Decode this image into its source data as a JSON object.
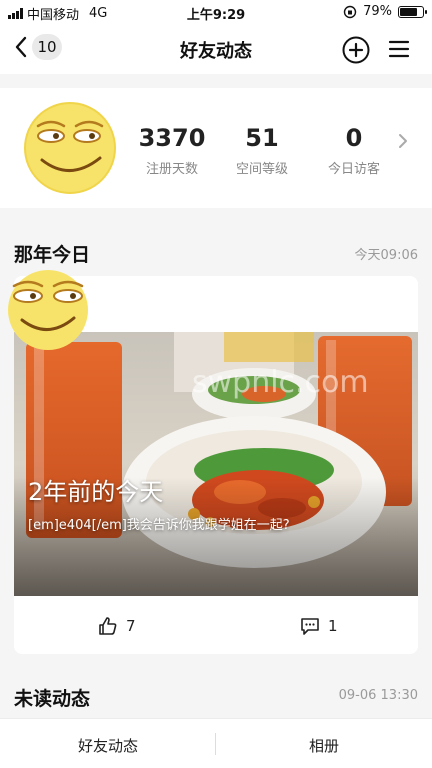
{
  "status": {
    "carrier": "中国移动",
    "network": "4G",
    "time": "上午9:29",
    "battery_text": "79%",
    "battery_level": 0.79
  },
  "nav": {
    "back_count": "10",
    "title": "好友动态",
    "add_icon": "plus-circle-icon",
    "menu_icon": "hamburger-menu-icon"
  },
  "profile": {
    "stats": [
      {
        "value": "3370",
        "label": "注册天数"
      },
      {
        "value": "51",
        "label": "空间等级"
      },
      {
        "value": "0",
        "label": "今日访客"
      }
    ]
  },
  "memory": {
    "section_title": "那年今日",
    "section_time": "今天09:06",
    "overlay_title": "2年前的今天",
    "overlay_text": "[em]e404[/em]我会告诉你我跟学姐在一起?",
    "watermark": "swpnlc.com",
    "likes": "7",
    "comments": "1"
  },
  "unread": {
    "section_title": "未读动态",
    "section_time": "09-06 13:30"
  },
  "tabs": [
    {
      "label": "好友动态"
    },
    {
      "label": "相册"
    }
  ]
}
